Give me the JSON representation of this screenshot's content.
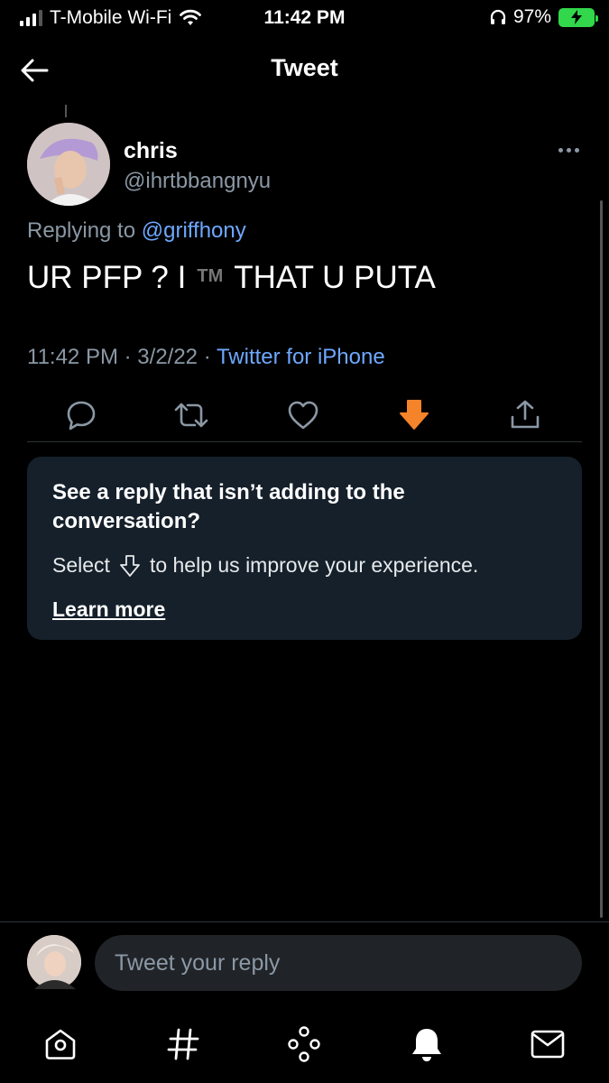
{
  "status_bar": {
    "carrier": "T-Mobile Wi-Fi",
    "time": "11:42 PM",
    "battery": "97%"
  },
  "header": {
    "title": "Tweet"
  },
  "tweet": {
    "author_name": "chris",
    "author_handle": "@ihrtbbangnyu",
    "replying_prefix": "Replying to",
    "replying_mention": "@griffhony",
    "text_before": "UR PFP ? I",
    "text_mark": "TM",
    "text_after": "THAT U PUTA",
    "time": "11:42 PM",
    "date": "3/2/22",
    "source": "Twitter for iPhone",
    "separator": "·"
  },
  "info_card": {
    "title": "See a reply that isn’t adding to the conversation?",
    "body_before": "Select",
    "body_after": "to help us improve your experience.",
    "link": "Learn more"
  },
  "reply_bar": {
    "placeholder": "Tweet your reply"
  },
  "colors": {
    "background": "#000000",
    "link": "#6ea8ff",
    "downvote": "#f4832a",
    "card": "#15202b",
    "muted": "#8b98a5"
  },
  "icons": {
    "back": "arrow-left-icon",
    "more": "more-icon",
    "reply": "reply-icon",
    "retweet": "retweet-icon",
    "like": "heart-icon",
    "downvote": "downvote-icon",
    "share": "share-icon",
    "home": "home-icon",
    "explore": "hashtag-icon",
    "spaces": "spaces-icon",
    "notifications": "bell-icon",
    "messages": "mail-icon"
  }
}
